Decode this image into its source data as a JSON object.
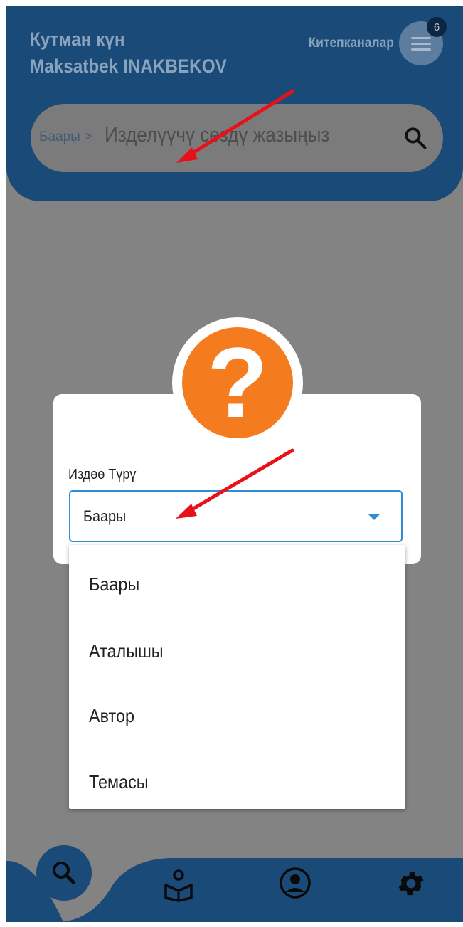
{
  "header": {
    "greeting": "Кутман күн",
    "user_name": "Maksatbek INAKBEKOV",
    "libraries_label": "Китепканалар",
    "notification_count": "6"
  },
  "search": {
    "breadcrumb": "Баары >",
    "placeholder": "Изделүүчү сөздү жазыңыз"
  },
  "dialog": {
    "field_label": "Издөө Түрү",
    "selected_value": "Баары",
    "options": [
      "Баары",
      "Аталышы",
      "Автор",
      "Темасы"
    ]
  },
  "bottom_nav": {
    "items": [
      "search-icon",
      "book-reader-icon",
      "user-icon",
      "gear-icon"
    ]
  },
  "colors": {
    "header_blue_dimmed": "#1a4a78",
    "accent_orange": "#f47c1f",
    "select_border": "#2f8fd6",
    "arrow_red": "#e8111a"
  }
}
